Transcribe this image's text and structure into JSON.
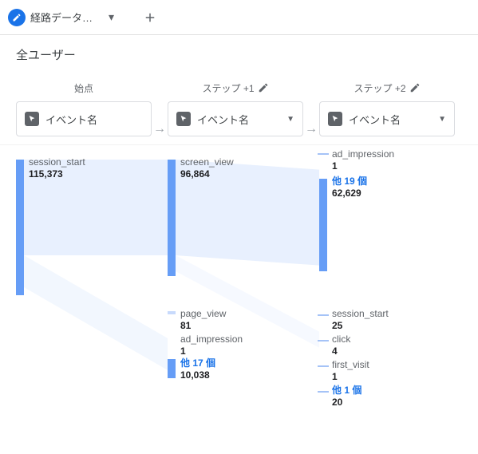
{
  "tab": {
    "label": "経路データ探…"
  },
  "segment": "全ユーザー",
  "steps": {
    "start_title": "始点",
    "s1_title": "ステップ +1",
    "s2_title": "ステップ +2",
    "dropdown_label": "イベント名"
  },
  "arrow": "→",
  "nodes": {
    "start": {
      "name": "session_start",
      "value": "115,373"
    },
    "s1a": {
      "name": "screen_view",
      "value": "96,864"
    },
    "s1b": {
      "name": "page_view",
      "value": "81"
    },
    "s1c": {
      "name": "ad_impression",
      "value": "1"
    },
    "s1more": {
      "label": "他 17 個",
      "value": "10,038"
    },
    "s2a": {
      "name": "ad_impression",
      "value": "1"
    },
    "s2more1": {
      "label": "他 19 個",
      "value": "62,629"
    },
    "s2b": {
      "name": "session_start",
      "value": "25"
    },
    "s2c": {
      "name": "click",
      "value": "4"
    },
    "s2d": {
      "name": "first_visit",
      "value": "1"
    },
    "s2more2": {
      "label": "他 1 個",
      "value": "20"
    }
  }
}
